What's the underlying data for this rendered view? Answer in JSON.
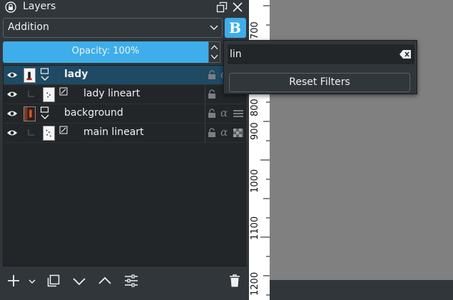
{
  "window": {
    "title": "Layers"
  },
  "blending": {
    "mode": "Addition",
    "button_glyph": "B"
  },
  "opacity": {
    "label": "Opacity:  100%",
    "value_percent": 100
  },
  "layers": [
    {
      "name": "lady",
      "kind": "group",
      "selected": true,
      "indent": 0
    },
    {
      "name": "lady lineart",
      "kind": "paint",
      "selected": false,
      "indent": 1
    },
    {
      "name": "background",
      "kind": "group",
      "selected": false,
      "indent": 0
    },
    {
      "name": "main lineart",
      "kind": "paint",
      "selected": false,
      "indent": 1
    }
  ],
  "filter_popup": {
    "value": "lin",
    "reset_label": "Reset Filters"
  },
  "ruler": {
    "labels": [
      "700",
      "800",
      "900",
      "1000",
      "1100",
      "1200"
    ]
  },
  "colors": {
    "accent": "#3daee9",
    "panel_bg": "#31363b",
    "list_bg": "#232629",
    "selected_row": "#1e4a63",
    "canvas": "#808080"
  },
  "toolbar": {
    "icons": [
      "add-icon",
      "chevron-down-icon",
      "duplicate-icon",
      "move-down-icon",
      "move-up-icon",
      "properties-icon",
      "trash-icon"
    ]
  }
}
